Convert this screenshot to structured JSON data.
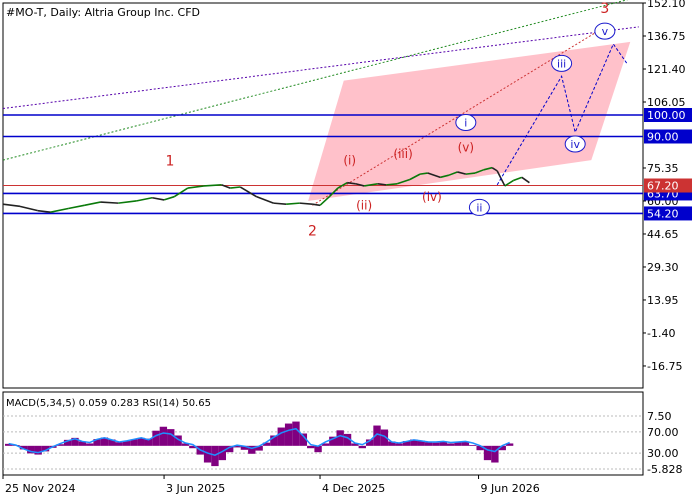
{
  "chart_data": {
    "type": "line",
    "title": "#MO-T, Daily:  Altria Group Inc. CFD",
    "colors": {
      "price_up": "#0a7a0a",
      "price_down": "#222222",
      "level_line": "#0000cc",
      "current_price_line": "#cc3333",
      "forecast_channel": "#ffb6c1",
      "primary_wave_label": "#cc2222",
      "minor_wave_label": "#cc2222",
      "minute_wave_label": "#1a1acc",
      "macd_histogram": "#800080",
      "rsi_line": "#1e90ff",
      "green_trendline": "#228b22",
      "purple_trendline": "#5500aa"
    },
    "price_axis": {
      "ylim": [
        -27,
        152.1
      ],
      "ticks": [
        "152.10",
        "136.75",
        "121.40",
        "106.05",
        "75.35",
        "60.00",
        "44.65",
        "29.30",
        "13.95",
        "-1.40",
        "-16.75"
      ]
    },
    "time_axis": {
      "ticks": [
        "25 Nov 2024",
        "3 Jun 2025",
        "4 Dec 2025",
        "9 Jun 2026"
      ]
    },
    "price_series": {
      "name": "",
      "x": [
        "2024-11-25",
        "2024-12-15",
        "2025-01-05",
        "2025-01-20",
        "2025-02-10",
        "2025-03-01",
        "2025-03-20",
        "2025-04-10",
        "2025-05-01",
        "2025-05-20",
        "2025-06-03",
        "2025-06-15",
        "2025-07-01",
        "2025-07-20",
        "2025-08-10",
        "2025-08-20",
        "2025-09-01",
        "2025-09-20",
        "2025-10-10",
        "2025-10-25",
        "2025-11-10",
        "2025-11-25",
        "2025-12-04",
        "2025-12-15",
        "2025-12-25",
        "2026-01-05",
        "2026-01-15",
        "2026-01-25",
        "2026-02-10",
        "2026-02-20",
        "2026-03-05",
        "2026-03-20",
        "2026-04-01",
        "2026-04-10",
        "2026-04-25",
        "2026-05-05",
        "2026-05-15",
        "2026-05-25",
        "2026-06-05",
        "2026-06-15",
        "2026-06-25",
        "2026-07-01",
        "2026-07-10",
        "2026-07-20",
        "2026-07-30",
        "2026-08-08"
      ],
      "y": [
        58.5,
        57.5,
        55.5,
        54.8,
        56.5,
        58.0,
        59.5,
        59.0,
        60.0,
        61.5,
        60.5,
        62.0,
        66.0,
        67.0,
        67.5,
        66.0,
        66.5,
        62.0,
        59.0,
        58.5,
        59.0,
        58.5,
        58.0,
        62.0,
        66.0,
        68.5,
        68.0,
        67.0,
        68.0,
        67.5,
        68.0,
        70.0,
        72.5,
        73.0,
        71.0,
        72.0,
        73.5,
        72.5,
        73.0,
        74.5,
        75.5,
        74.0,
        67.0,
        69.5,
        71.0,
        68.5
      ]
    },
    "horizontal_levels": [
      {
        "value": 100.0,
        "label": "100.00"
      },
      {
        "value": 90.0,
        "label": "90.00"
      },
      {
        "value": 63.5,
        "label": "63.70"
      },
      {
        "value": 54.2,
        "label": "54.20"
      }
    ],
    "current_price": {
      "value": 67.2,
      "label": "67.20"
    },
    "wave_labels": [
      {
        "text": "1",
        "date": "2025-06-10",
        "price": 76.5,
        "style": "primary"
      },
      {
        "text": "2",
        "date": "2025-11-25",
        "price": 44.0,
        "style": "primary"
      },
      {
        "text": "3",
        "date": "2026-11-05",
        "price": 147.5,
        "style": "primary"
      },
      {
        "text": "(i)",
        "date": "2026-01-08",
        "price": 77.0,
        "style": "minor"
      },
      {
        "text": "(ii)",
        "date": "2026-01-25",
        "price": 56.0,
        "style": "minor"
      },
      {
        "text": "(iii)",
        "date": "2026-03-12",
        "price": 80.0,
        "style": "minor"
      },
      {
        "text": "(iv)",
        "date": "2026-04-15",
        "price": 60.0,
        "style": "minor"
      },
      {
        "text": "(v)",
        "date": "2026-05-25",
        "price": 83.0,
        "style": "minor"
      },
      {
        "text": "i",
        "date": "2026-05-25",
        "price": 96.5,
        "style": "minute"
      },
      {
        "text": "ii",
        "date": "2026-06-10",
        "price": 57.0,
        "style": "minute"
      },
      {
        "text": "iii",
        "date": "2026-09-15",
        "price": 124.0,
        "style": "minute"
      },
      {
        "text": "iv",
        "date": "2026-10-01",
        "price": 86.5,
        "style": "minute"
      },
      {
        "text": "v",
        "date": "2026-11-05",
        "price": 139.0,
        "style": "minute"
      }
    ],
    "forecast_path": {
      "x": [
        "2026-07-01",
        "2026-09-15",
        "2026-10-01",
        "2026-11-15",
        "2026-12-01"
      ],
      "y": [
        67.5,
        118.0,
        92.0,
        133.0,
        124.0
      ]
    },
    "forecast_channel": {
      "x": [
        "2025-11-20",
        "2026-01-01",
        "2026-12-05",
        "2026-10-20"
      ],
      "y": [
        60.0,
        116.0,
        134.0,
        79.0
      ]
    },
    "trendlines": [
      {
        "x": [
          "2024-11-25",
          "2026-12-15"
        ],
        "y": [
          103.0,
          141.0
        ],
        "color": "purple"
      },
      {
        "x": [
          "2024-11-25",
          "2026-12-15"
        ],
        "y": [
          79.0,
          155.0
        ],
        "color": "green"
      },
      {
        "x": [
          "2025-11-25",
          "2026-11-01"
        ],
        "y": [
          58.0,
          140.0
        ],
        "color": "red"
      }
    ],
    "indicator": {
      "label": "MACD(5,34,5) 0.059 0.283 RSI(14) 50.65",
      "ylim": [
        -5.828,
        7.5
      ],
      "ticks": [
        "7.50",
        "70.00",
        "30.00",
        "-5.828"
      ],
      "macd_histogram": [
        0.5,
        0.2,
        -0.9,
        -1.9,
        -2.2,
        -1.4,
        -0.5,
        0.4,
        1.5,
        2.0,
        1.1,
        0.6,
        1.7,
        2.1,
        1.6,
        0.9,
        1.2,
        1.6,
        2.0,
        1.8,
        3.8,
        4.8,
        4.2,
        2.6,
        0.6,
        -0.6,
        -2.2,
        -4.2,
        -5.1,
        -3.6,
        -1.6,
        -0.4,
        -1.0,
        -2.0,
        -1.2,
        0.8,
        2.6,
        4.6,
        5.6,
        6.1,
        3.1,
        -0.6,
        -1.6,
        0.6,
        2.3,
        3.9,
        3.0,
        0.6,
        -0.6,
        1.6,
        5.1,
        4.1,
        1.1,
        0.6,
        1.2,
        1.6,
        1.3,
        0.9,
        0.8,
        1.1,
        0.6,
        0.9,
        1.1,
        0.2,
        -1.1,
        -3.6,
        -4.2,
        -1.1,
        0.6
      ],
      "rsi": [
        48,
        45,
        38,
        33,
        31,
        35,
        42,
        48,
        53,
        57,
        52,
        50,
        56,
        59,
        55,
        51,
        53,
        56,
        59,
        55,
        63,
        68,
        66,
        56,
        49,
        46,
        36,
        30,
        26,
        33,
        41,
        45,
        43,
        39,
        43,
        51,
        60,
        68,
        73,
        76,
        62,
        46,
        43,
        51,
        57,
        63,
        59,
        49,
        46,
        53,
        66,
        62,
        51,
        49,
        52,
        55,
        53,
        51,
        51,
        52,
        50,
        51,
        52,
        49,
        44,
        36,
        33,
        44,
        50
      ]
    }
  }
}
